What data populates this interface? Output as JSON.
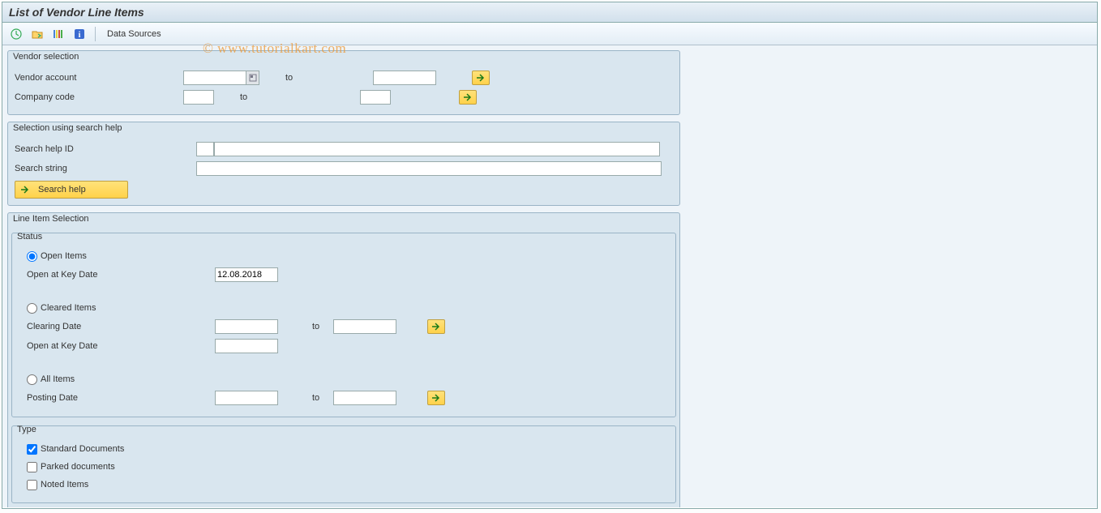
{
  "title": "List of Vendor Line Items",
  "toolbar": {
    "data_sources": "Data Sources"
  },
  "watermark": "© www.tutorialkart.com",
  "vendor_selection": {
    "title": "Vendor selection",
    "vendor_account_label": "Vendor account",
    "vendor_from": "",
    "vendor_to": "",
    "company_code_label": "Company code",
    "company_from": "",
    "company_to": "",
    "to_text": "to"
  },
  "search_help": {
    "title": "Selection using search help",
    "id_label": "Search help ID",
    "id_value": "",
    "string_label": "Search string",
    "string_value": "",
    "button_label": "Search help"
  },
  "line_item": {
    "title": "Line Item Selection",
    "status": {
      "title": "Status",
      "open_items": "Open Items",
      "open_key_date_label": "Open at Key Date",
      "open_key_date": "12.08.2018",
      "cleared_items": "Cleared Items",
      "clearing_date_label": "Clearing Date",
      "clearing_date_from": "",
      "clearing_date_to": "",
      "open_key_date2_label": "Open at Key Date",
      "open_key_date2": "",
      "all_items": "All Items",
      "posting_date_label": "Posting Date",
      "posting_date_from": "",
      "posting_date_to": "",
      "to_text": "to",
      "selected": "open"
    },
    "type": {
      "title": "Type",
      "standard": "Standard Documents",
      "parked": "Parked documents",
      "noted": "Noted Items",
      "standard_checked": true,
      "parked_checked": false,
      "noted_checked": false
    }
  }
}
